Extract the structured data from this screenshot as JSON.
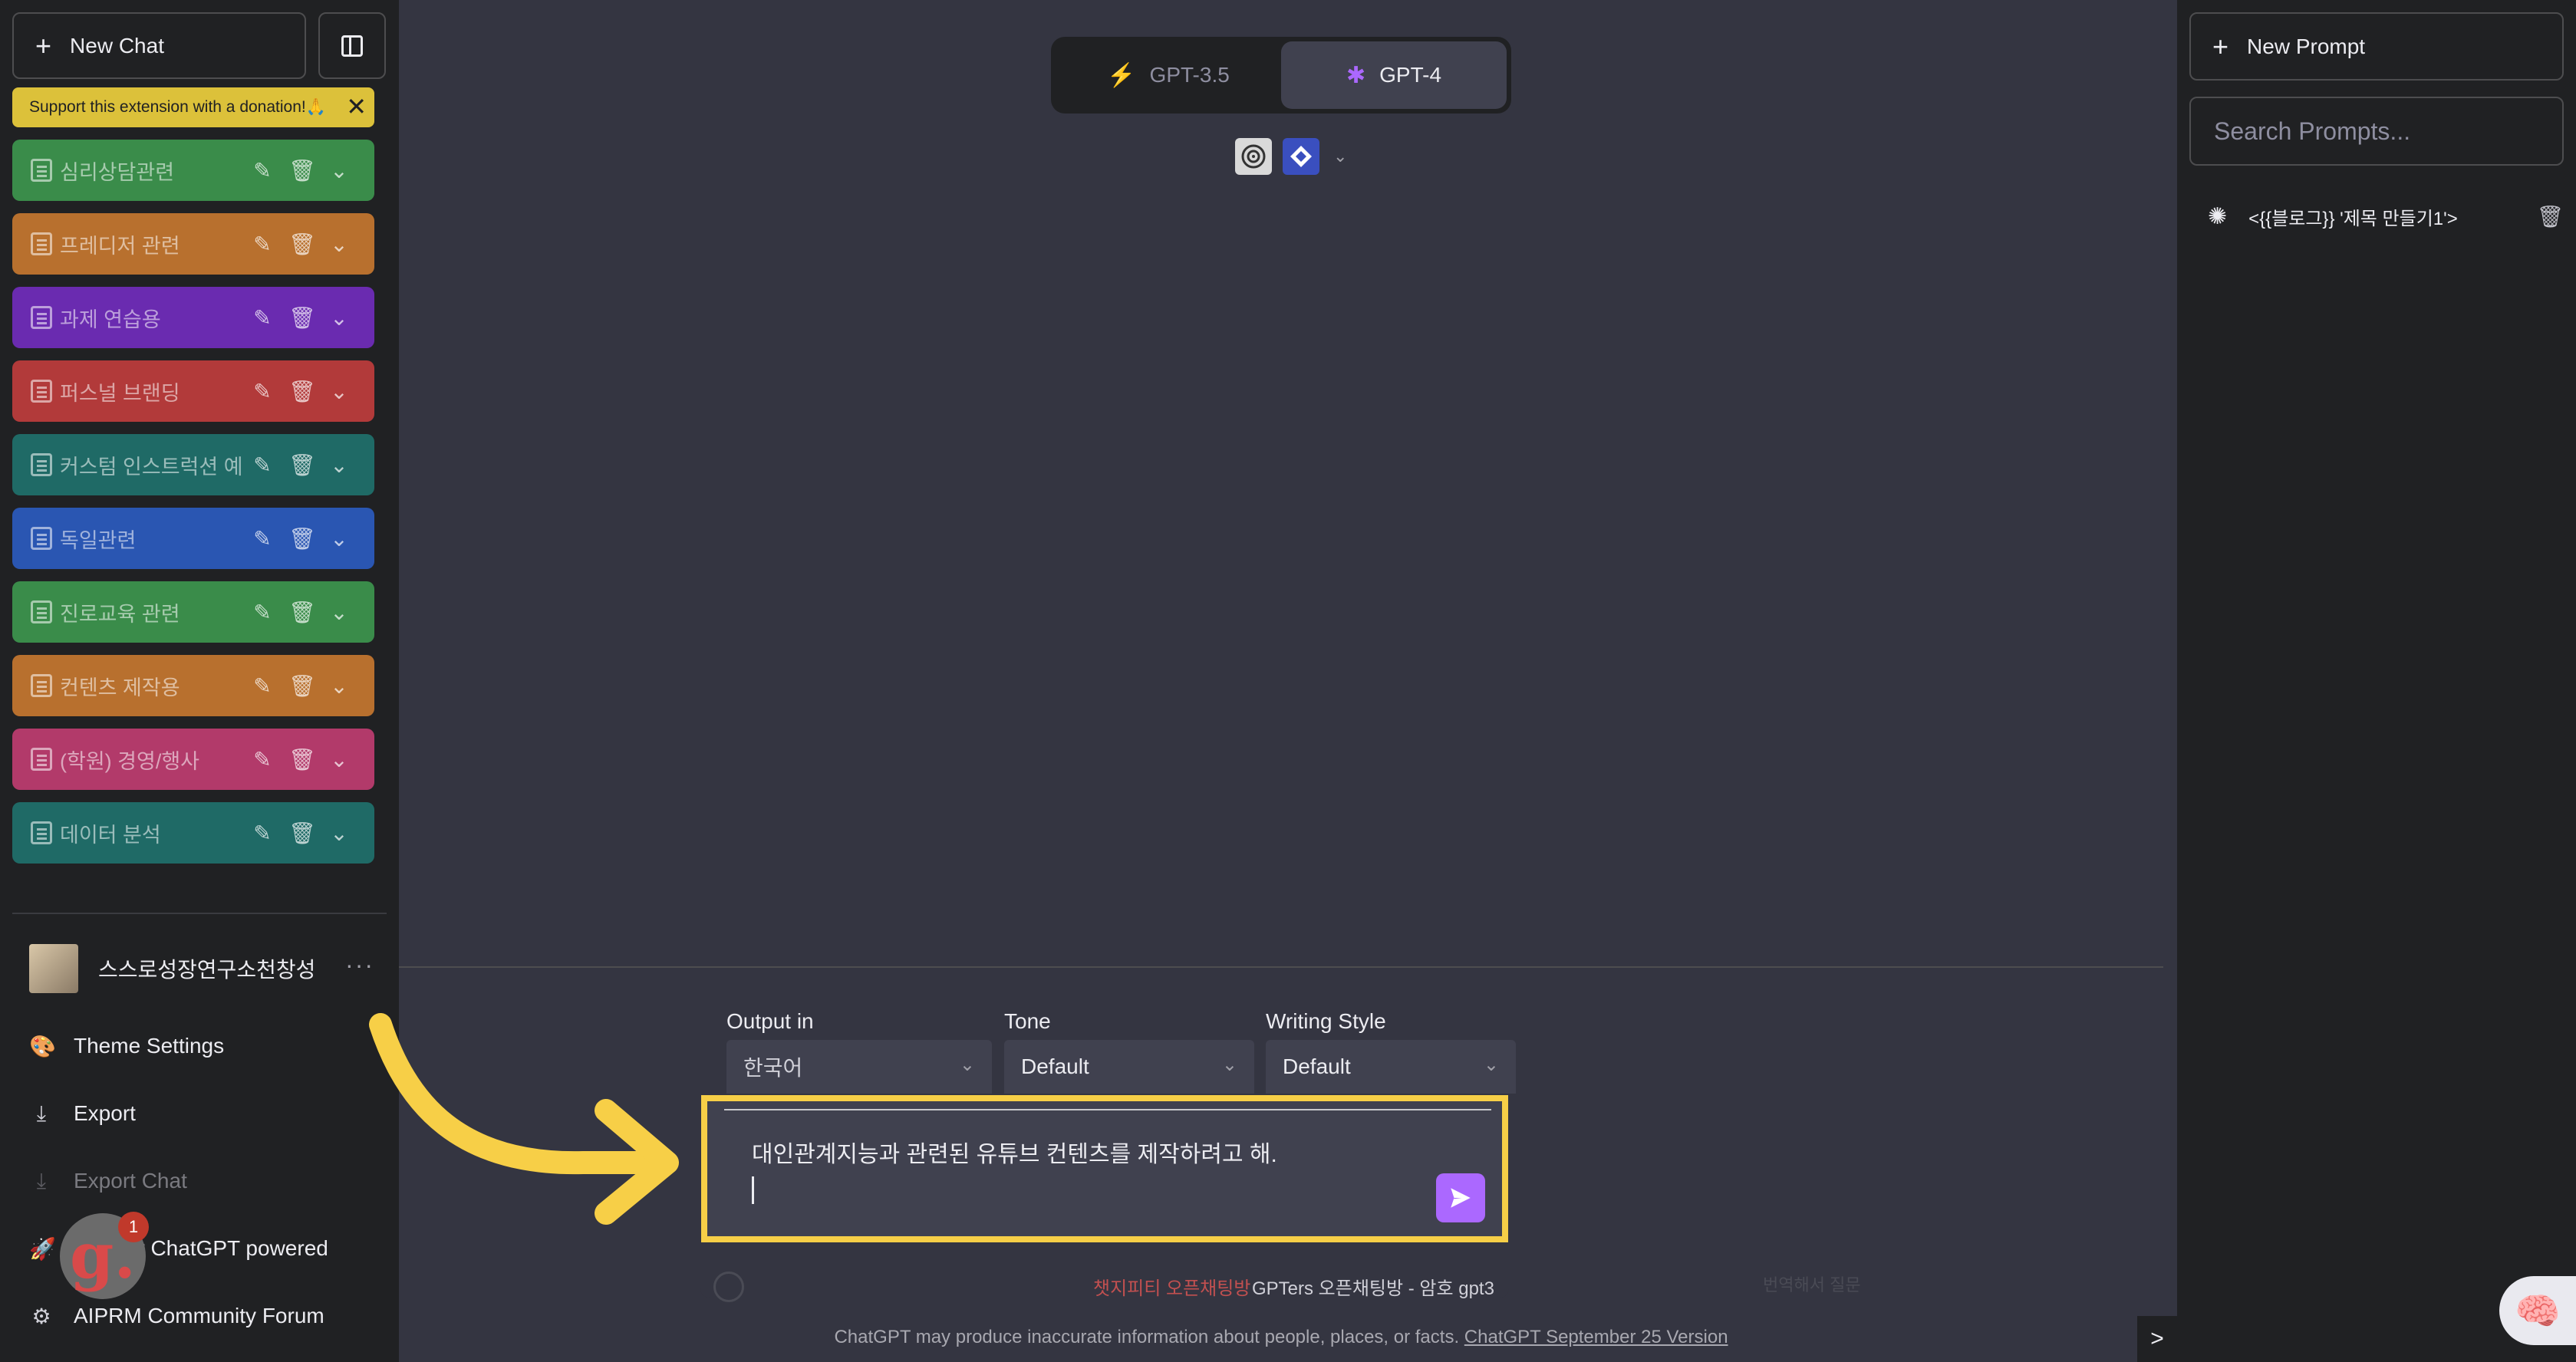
{
  "sidebar": {
    "new_chat": "New Chat",
    "donation_banner": "Support this extension with a donation!🙏",
    "folders": [
      {
        "label": "심리상담관련",
        "color": "#3a8c4a"
      },
      {
        "label": "프레디저 관련",
        "color": "#b8702e"
      },
      {
        "label": "과제 연습용",
        "color": "#6a2bb0"
      },
      {
        "label": "퍼스널 브랜딩",
        "color": "#b23a3a"
      },
      {
        "label": "커스텀 인스트럭션 예",
        "color": "#1f6a66"
      },
      {
        "label": "독일관련",
        "color": "#2a56b2"
      },
      {
        "label": "진로교육 관련",
        "color": "#3a8c4a"
      },
      {
        "label": "컨텐츠 제작용",
        "color": "#b8702e"
      },
      {
        "label": "(학원) 경영/행사",
        "color": "#b23a6a"
      },
      {
        "label": "데이터 분석",
        "color": "#1f6a66"
      }
    ],
    "user_name": "스스로성장연구소천창성",
    "menu": {
      "theme_settings": "Theme Settings",
      "export": "Export",
      "export_chat": "Export Chat",
      "powered": "for ChatGPT powered",
      "community": "AIPRM Community Forum"
    },
    "badge_letter": "g.",
    "badge_count": "1"
  },
  "main": {
    "models": {
      "gpt35": "GPT-3.5",
      "gpt4": "GPT-4",
      "active": "GPT-4"
    },
    "options": {
      "output_label": "Output in",
      "output_value": "한국어",
      "tone_label": "Tone",
      "tone_value": "Default",
      "style_label": "Writing Style",
      "style_value": "Default"
    },
    "input_text": "대인관계지능과 관련된 유튜브 컨텐츠를 제작하려고 해.",
    "links": {
      "red": "챗지피티 오픈채팅방",
      "white": "GPTers 오픈채팅방 - 암호 gpt3",
      "faded": "번역해서 질문"
    },
    "footer_text": "ChatGPT may produce inaccurate information about people, places, or facts. ",
    "footer_link": "ChatGPT September 25 Version"
  },
  "rightbar": {
    "new_prompt": "New Prompt",
    "search_placeholder": "Search Prompts...",
    "prompt_item": "<{{블로그}} '제목 만들기1'>",
    "collapse": ">"
  },
  "colors": {
    "accent": "#ab68ff",
    "highlight": "#f7cf47",
    "donate": "#dcc13a"
  }
}
